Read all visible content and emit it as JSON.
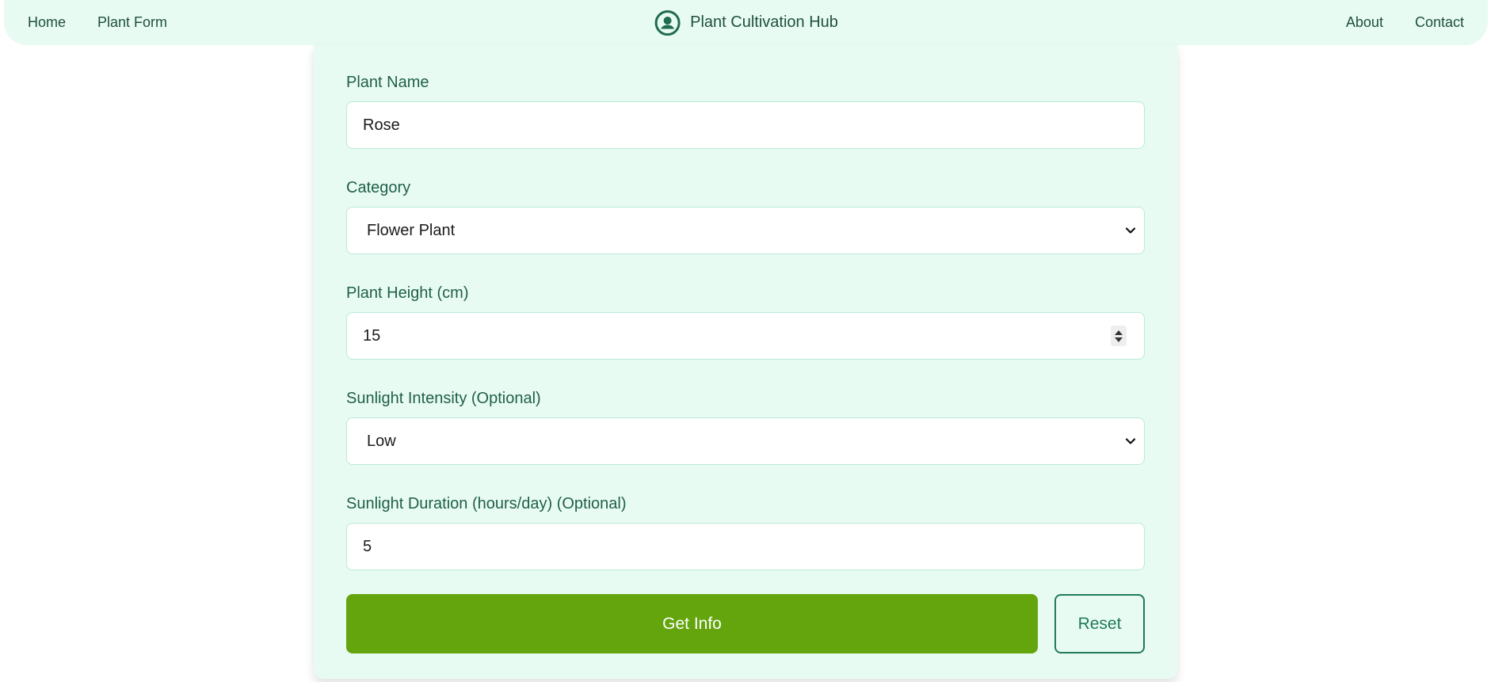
{
  "nav": {
    "left": [
      {
        "label": "Home"
      },
      {
        "label": "Plant Form"
      }
    ],
    "brand": {
      "title": "Plant Cultivation Hub",
      "icon": "user-circle-icon"
    },
    "right": [
      {
        "label": "About"
      },
      {
        "label": "Contact"
      }
    ]
  },
  "form": {
    "plant_name": {
      "label": "Plant Name",
      "value": "Rose"
    },
    "category": {
      "label": "Category",
      "value": "Flower Plant"
    },
    "plant_height": {
      "label": "Plant Height (cm)",
      "value": "15"
    },
    "sunlight_intensity": {
      "label": "Sunlight Intensity (Optional)",
      "value": "Low"
    },
    "sunlight_duration": {
      "label": "Sunlight Duration (hours/day) (Optional)",
      "value": "5"
    }
  },
  "actions": {
    "submit_label": "Get Info",
    "reset_label": "Reset"
  },
  "colors": {
    "nav_bg": "#e8fbf2",
    "card_bg": "#e8fbf2",
    "primary_button": "#64a50d",
    "secondary_border": "#1f7a5a",
    "text": "#1f4f3e"
  }
}
